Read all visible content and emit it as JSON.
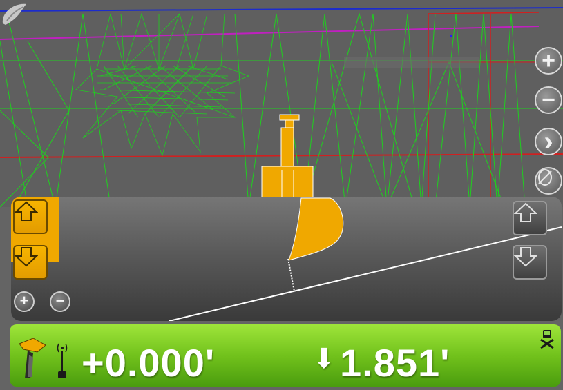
{
  "controls": {
    "zoom_in_glyph": "+",
    "zoom_out_glyph": "−",
    "next_glyph": "›",
    "profile_zoom_in_glyph": "+",
    "profile_zoom_out_glyph": "−"
  },
  "icons": {
    "logo": "leaf-logo-icon",
    "view_toggle": "view-toggle-icon",
    "up_arrow": "up-arrow-icon",
    "down_arrow": "down-arrow-icon",
    "excavator": "excavator-icon",
    "antenna": "antenna-icon",
    "machine_status": "machine-status-icon"
  },
  "status": {
    "elevation_offset": "+0.000'",
    "cut_fill": "1.851'",
    "cut_fill_direction": "down"
  },
  "colors": {
    "accent_orange": "#f0a800",
    "status_green": "#72c21c",
    "mesh_green": "#1fd01f",
    "boundary_red": "#d02020",
    "alignment_magenta": "#c020c0"
  }
}
